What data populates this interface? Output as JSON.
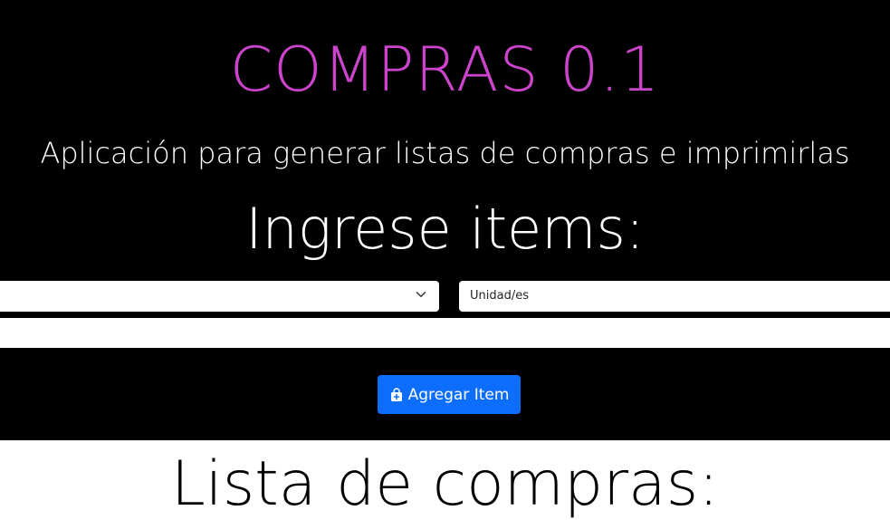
{
  "header": {
    "title": "COMPRAS 0.1",
    "subtitle": "Aplicación para generar listas de compras e imprimirlas",
    "section_heading": "Ingrese items:"
  },
  "form": {
    "product_select_value": "",
    "units_placeholder": "Unidad/es",
    "notes_value": "",
    "add_button_label": "Agregar Item"
  },
  "list": {
    "heading": "Lista de compras:"
  },
  "icons": {
    "select_chevron": "chevron-down-icon",
    "add_button": "bag-plus-icon"
  },
  "colors": {
    "title": "#cc44cc",
    "top_background": "#000000",
    "button": "#0d6efd",
    "page_background": "#ffffff"
  }
}
